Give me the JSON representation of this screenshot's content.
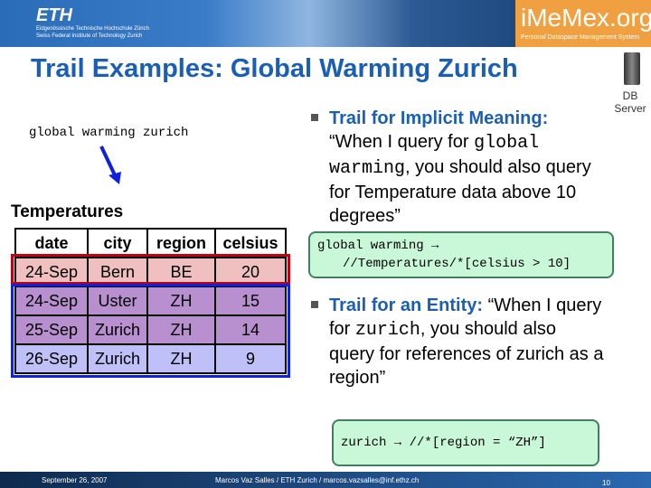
{
  "header": {
    "eth_logo": "ETH",
    "eth_sub1": "Eidgenössische Technische Hochschule Zürich",
    "eth_sub2": "Swiss Federal Institute of Technology Zurich",
    "imemex": "iMeMex.org",
    "imemex_sub": "Personal Dataspace Management System"
  },
  "title": "Trail Examples: Global Warming Zurich",
  "server": {
    "icon": "server-icon",
    "label1": "DB",
    "label2": "Server"
  },
  "query": "global warming zurich",
  "table": {
    "name": "Temperatures",
    "columns": [
      "date",
      "city",
      "region",
      "celsius"
    ],
    "rows": [
      [
        "24-Sep",
        "Bern",
        "BE",
        "20"
      ],
      [
        "24-Sep",
        "Uster",
        "ZH",
        "15"
      ],
      [
        "25-Sep",
        "Zurich",
        "ZH",
        "14"
      ],
      [
        "26-Sep",
        "Zurich",
        "ZH",
        "9"
      ]
    ],
    "highlight_colors": {
      "implicit": "#c00010",
      "entity": "#1020e0"
    }
  },
  "bullet1": {
    "label": "Trail for Implicit Meaning:",
    "t1": "“When I query for ",
    "code": "global warming",
    "t2": ", you should also query for Temperature data above 10 degrees”"
  },
  "trail1": {
    "line1": "global warming →",
    "line2": "//Temperatures/*[celsius > 10]"
  },
  "bullet2": {
    "label": "Trail for an Entity:",
    "t1": " “When I query for ",
    "code": "zurich",
    "t2": ", you should also query for references of zurich as a region”"
  },
  "trail2": "zurich → //*[region = “ZH”]",
  "footer": {
    "date": "September 26, 2007",
    "author": "Marcos Vaz Salles / ETH Zurich / marcos.vazsalles@inf.ethz.ch",
    "page": "10"
  }
}
